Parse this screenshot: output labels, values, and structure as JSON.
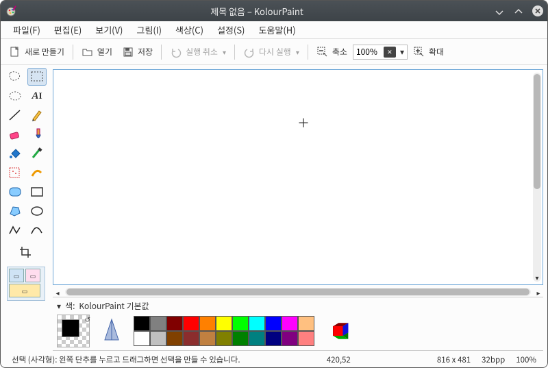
{
  "window": {
    "title": "제목 없음 – KolourPaint"
  },
  "menu": {
    "file": "파일(F)",
    "edit": "편집(E)",
    "view": "보기(V)",
    "image": "그림(I)",
    "color": "색상(C)",
    "settings": "설정(S)",
    "help": "도움말(H)"
  },
  "toolbar": {
    "new": "새로 만들기",
    "open": "열기",
    "save": "저장",
    "undo": "실행 취소",
    "redo": "다시 실행",
    "zoom_out": "축소",
    "zoom_value": "100%",
    "zoom_in": "확대"
  },
  "colorpanel": {
    "label_prefix": "색:",
    "label_name": "KolourPaint 기본값",
    "palette_row1": [
      "#000000",
      "#808080",
      "#800000",
      "#ff0000",
      "#ff8000",
      "#ffff00",
      "#00ff00",
      "#00ffff",
      "#0000ff",
      "#ff00ff",
      "#ffc080"
    ],
    "palette_row2": [
      "#ffffff",
      "#c0c0c0",
      "#804000",
      "#8b2d2d",
      "#c08040",
      "#808000",
      "#008000",
      "#008080",
      "#000080",
      "#800080",
      "#ff8080"
    ]
  },
  "statusbar": {
    "hint": "선택 (사각형): 왼쪽 단추를 누르고 드래그하면 선택을 만들 수 있습니다.",
    "cursor_pos": "420,52",
    "canvas_size": "816 x 481",
    "bpp": "32bpp",
    "zoom": "100%"
  },
  "tools": {
    "freeform_select": "freeform-select",
    "rect_select": "rect-select",
    "ellipse_select": "ellipse-select",
    "text": "text",
    "line": "line",
    "pencil": "pencil",
    "eraser": "eraser",
    "brush": "brush",
    "fill": "fill",
    "picker": "color-picker",
    "spray": "spray",
    "rounded_rect": "rounded-rect",
    "rectangle": "rectangle",
    "polygon": "polygon",
    "ellipse": "ellipse",
    "curve": "curve",
    "connected": "connected-lines",
    "crop": "crop"
  }
}
